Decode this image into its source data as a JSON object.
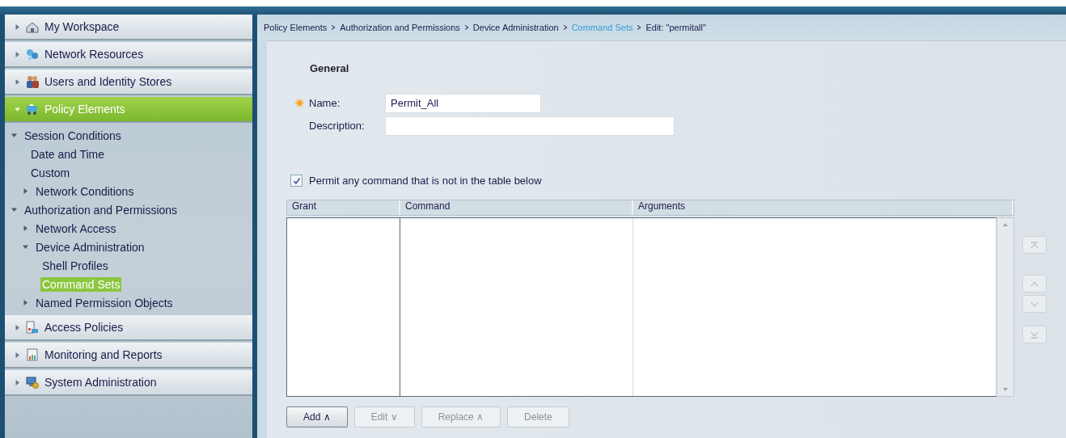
{
  "sidebar": {
    "sections": [
      {
        "label": "My Workspace",
        "expanded": false,
        "selected": false
      },
      {
        "label": "Network Resources",
        "expanded": false,
        "selected": false
      },
      {
        "label": "Users and Identity Stores",
        "expanded": false,
        "selected": false
      },
      {
        "label": "Policy Elements",
        "expanded": true,
        "selected": true,
        "children": [
          {
            "label": "Session Conditions",
            "kind": "folder",
            "expanded": true,
            "selected": false,
            "children": [
              {
                "label": "Date and Time",
                "kind": "leaf",
                "selected": false
              },
              {
                "label": "Custom",
                "kind": "leaf",
                "selected": false
              },
              {
                "label": "Network Conditions",
                "kind": "folder",
                "expanded": false,
                "selected": false
              }
            ]
          },
          {
            "label": "Authorization and Permissions",
            "kind": "folder",
            "expanded": true,
            "selected": false,
            "children": [
              {
                "label": "Network Access",
                "kind": "folder",
                "expanded": false,
                "selected": false
              },
              {
                "label": "Device Administration",
                "kind": "folder",
                "expanded": true,
                "selected": false,
                "children": [
                  {
                    "label": "Shell Profiles",
                    "kind": "leaf",
                    "selected": false
                  },
                  {
                    "label": "Command Sets",
                    "kind": "leaf",
                    "selected": true
                  }
                ]
              },
              {
                "label": "Named Permission Objects",
                "kind": "folder",
                "expanded": false,
                "selected": false
              }
            ]
          }
        ]
      },
      {
        "label": "Access Policies",
        "expanded": false,
        "selected": false
      },
      {
        "label": "Monitoring and Reports",
        "expanded": false,
        "selected": false
      },
      {
        "label": "System Administration",
        "expanded": false,
        "selected": false
      }
    ]
  },
  "breadcrumb": [
    {
      "label": "Policy Elements",
      "kind": "text"
    },
    {
      "label": "Authorization and Permissions",
      "kind": "text"
    },
    {
      "label": "Device Administration",
      "kind": "text"
    },
    {
      "label": "Command Sets",
      "kind": "link"
    },
    {
      "label": "Edit: \"permitall\"",
      "kind": "text"
    }
  ],
  "form": {
    "section_title": "General",
    "fields": [
      {
        "label": "Name:",
        "value": "Permit_All",
        "required": true,
        "kind": "short"
      },
      {
        "label": "Description:",
        "required": false,
        "kind": "long"
      }
    ],
    "checkbox": {
      "label": "Permit any command that is not in the table below",
      "checked": true
    }
  },
  "table": {
    "columns": [
      "Grant",
      "Command",
      "Arguments"
    ]
  },
  "move_buttons": [
    {
      "kind": "top",
      "disabled": true
    },
    {
      "kind": "up",
      "disabled": true
    },
    {
      "kind": "down",
      "disabled": true
    },
    {
      "kind": "bottom",
      "disabled": true
    }
  ],
  "buttons": [
    {
      "label": "Add ∧",
      "disabled": false
    },
    {
      "label": "Edit ∨",
      "disabled": true
    },
    {
      "label": "Replace ∧",
      "disabled": true
    },
    {
      "label": "Delete",
      "disabled": true
    }
  ]
}
